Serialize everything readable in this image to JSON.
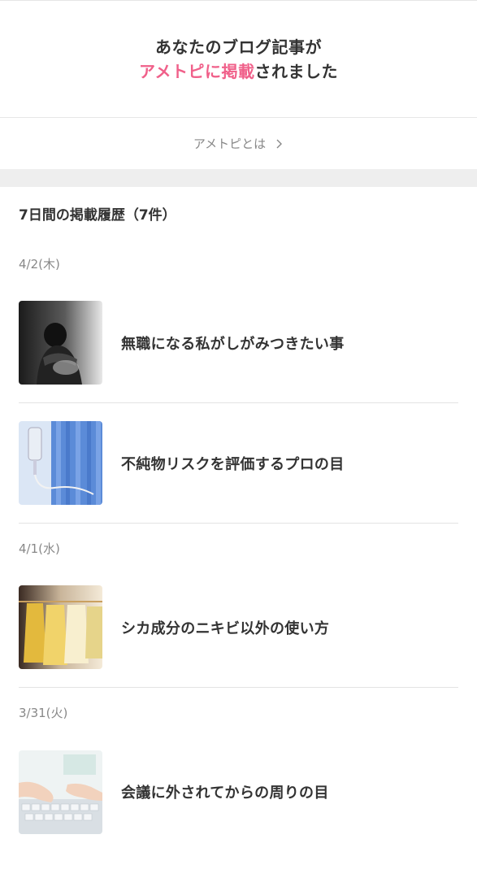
{
  "hero": {
    "line1": "あなたのブログ記事が",
    "accent": "アメトピに掲載",
    "line2_rest": "されました"
  },
  "about": {
    "label": "アメトピとは",
    "icon": "chevron-right-icon"
  },
  "history": {
    "title": "7日間の掲載履歴（7件）",
    "groups": [
      {
        "date": "4/2(木)",
        "articles": [
          {
            "title": "無職になる私がしがみつきたい事",
            "thumb": "sad-person-bw-image"
          },
          {
            "title": "不純物リスクを評価するプロの目",
            "thumb": "iv-drip-image"
          }
        ]
      },
      {
        "date": "4/1(水)",
        "articles": [
          {
            "title": "シカ成分のニキビ以外の使い方",
            "thumb": "clothes-rack-image"
          }
        ]
      },
      {
        "date": "3/31(火)",
        "articles": [
          {
            "title": "会議に外されてからの周りの目",
            "thumb": "keyboard-typing-image"
          }
        ]
      }
    ]
  },
  "colors": {
    "accent": "#f0608a",
    "text": "#333333",
    "muted": "#888888",
    "band": "#eeeeee"
  }
}
